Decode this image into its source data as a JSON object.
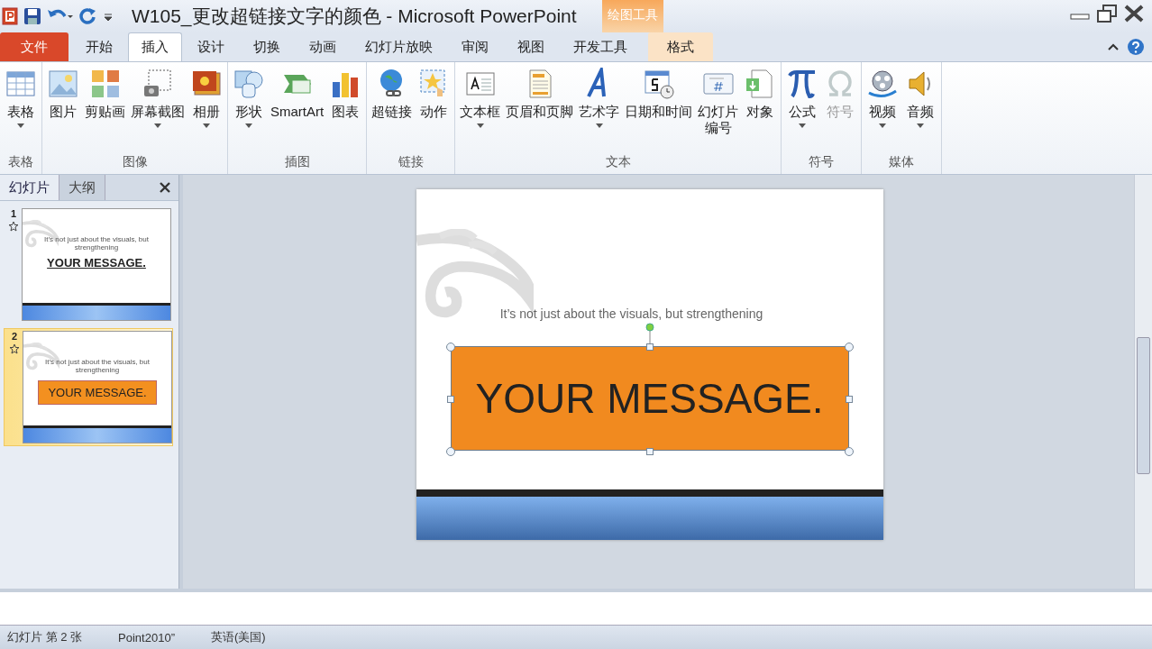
{
  "window": {
    "title": "W105_更改超链接文字的颜色 - Microsoft PowerPoint",
    "context_group": "绘图工具"
  },
  "tabs": [
    {
      "label": "文件",
      "kind": "file",
      "selected": false
    },
    {
      "label": "开始",
      "kind": "normal",
      "selected": false
    },
    {
      "label": "插入",
      "kind": "normal",
      "selected": true
    },
    {
      "label": "设计",
      "kind": "normal",
      "selected": false
    },
    {
      "label": "切换",
      "kind": "normal",
      "selected": false
    },
    {
      "label": "动画",
      "kind": "normal",
      "selected": false
    },
    {
      "label": "幻灯片放映",
      "kind": "normal",
      "selected": false
    },
    {
      "label": "审阅",
      "kind": "normal",
      "selected": false
    },
    {
      "label": "视图",
      "kind": "normal",
      "selected": false
    },
    {
      "label": "开发工具",
      "kind": "normal",
      "selected": false
    },
    {
      "label": "格式",
      "kind": "context",
      "selected": false
    }
  ],
  "ribbon_groups": [
    {
      "label": "表格",
      "buttons": [
        {
          "label": "表格",
          "kind": "table",
          "dropdown": true,
          "disabled": false
        }
      ]
    },
    {
      "label": "图像",
      "buttons": [
        {
          "label": "图片",
          "kind": "picture",
          "dropdown": false,
          "disabled": false
        },
        {
          "label": "剪贴画",
          "kind": "clipart",
          "dropdown": false,
          "disabled": false
        },
        {
          "label": "屏幕截图",
          "kind": "screenshot",
          "dropdown": true,
          "disabled": false
        },
        {
          "label": "相册",
          "kind": "album",
          "dropdown": true,
          "disabled": false
        }
      ]
    },
    {
      "label": "插图",
      "buttons": [
        {
          "label": "形状",
          "kind": "shapes",
          "dropdown": true,
          "disabled": false
        },
        {
          "label": "SmartArt",
          "kind": "smartart",
          "dropdown": false,
          "disabled": false
        },
        {
          "label": "图表",
          "kind": "chart",
          "dropdown": false,
          "disabled": false
        }
      ]
    },
    {
      "label": "链接",
      "buttons": [
        {
          "label": "超链接",
          "kind": "hyperlink",
          "dropdown": false,
          "disabled": false
        },
        {
          "label": "动作",
          "kind": "action",
          "dropdown": false,
          "disabled": false
        }
      ]
    },
    {
      "label": "文本",
      "buttons": [
        {
          "label": "文本框",
          "kind": "textbox",
          "dropdown": true,
          "disabled": false
        },
        {
          "label": "页眉和页脚",
          "kind": "header",
          "dropdown": false,
          "disabled": false
        },
        {
          "label": "艺术字",
          "kind": "wordart",
          "dropdown": true,
          "disabled": false
        },
        {
          "label": "日期和时间",
          "kind": "datetime",
          "dropdown": false,
          "disabled": false
        },
        {
          "label": "幻灯片编号",
          "kind": "slidenumber",
          "dropdown": false,
          "disabled": false
        },
        {
          "label": "对象",
          "kind": "object",
          "dropdown": false,
          "disabled": false
        }
      ]
    },
    {
      "label": "符号",
      "buttons": [
        {
          "label": "公式",
          "kind": "equation",
          "dropdown": true,
          "disabled": false
        },
        {
          "label": "符号",
          "kind": "symbol",
          "dropdown": false,
          "disabled": true
        }
      ]
    },
    {
      "label": "媒体",
      "buttons": [
        {
          "label": "视频",
          "kind": "video",
          "dropdown": true,
          "disabled": false
        },
        {
          "label": "音频",
          "kind": "audio",
          "dropdown": true,
          "disabled": false
        }
      ]
    }
  ],
  "slides_pane": {
    "tabs": [
      {
        "label": "幻灯片",
        "selected": true
      },
      {
        "label": "大纲",
        "selected": false
      }
    ]
  },
  "thumbnails": [
    {
      "number": "1",
      "subtitle": "It’s not just about the visuals, but strengthening",
      "message": "YOUR MESSAGE.",
      "kind": "underlined",
      "selected": false
    },
    {
      "number": "2",
      "subtitle": "It’s not just about the visuals, but strengthening",
      "message": "YOUR MESSAGE.",
      "kind": "boxed",
      "selected": true
    }
  ],
  "slide": {
    "subtitle": "It’s not just about the visuals, but strengthening",
    "message": "YOUR MESSAGE.",
    "shape_selected": true
  },
  "status_bar": [
    "幻灯片 第 2 张",
    "Point2010”",
    "英语(美国)"
  ]
}
